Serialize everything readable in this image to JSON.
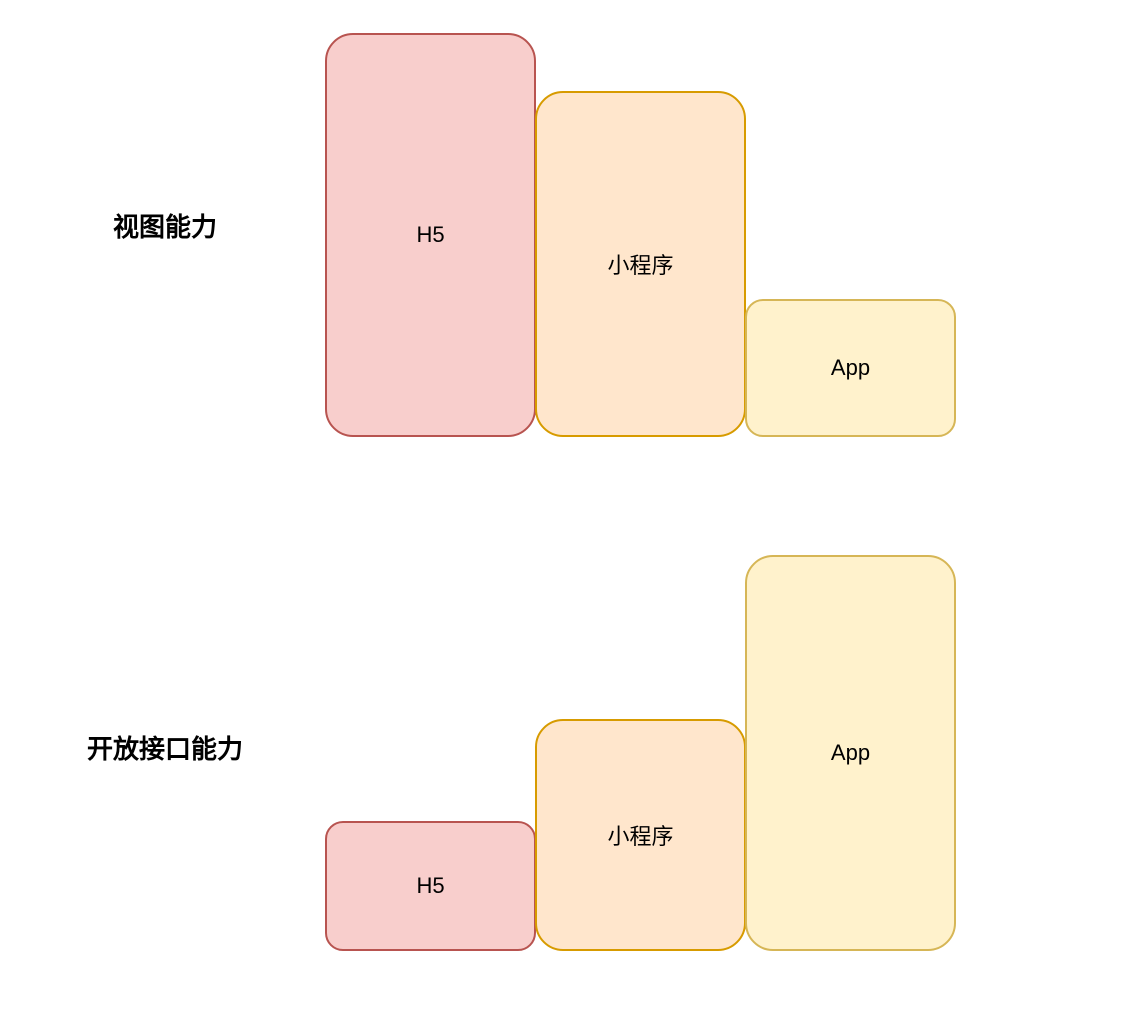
{
  "colors": {
    "h5_fill": "#f8cecc",
    "h5_stroke": "#b85450",
    "mini_fill": "#ffe6cc",
    "mini_stroke": "#d79b00",
    "app_fill": "#fff2cc",
    "app_stroke": "#d6b656"
  },
  "rows": {
    "view": {
      "label": "视图能力",
      "boxes": {
        "h5": "H5",
        "mini": "小程序",
        "app": "App"
      }
    },
    "api": {
      "label": "开放接口能力",
      "boxes": {
        "h5": "H5",
        "mini": "小程序",
        "app": "App"
      }
    }
  }
}
